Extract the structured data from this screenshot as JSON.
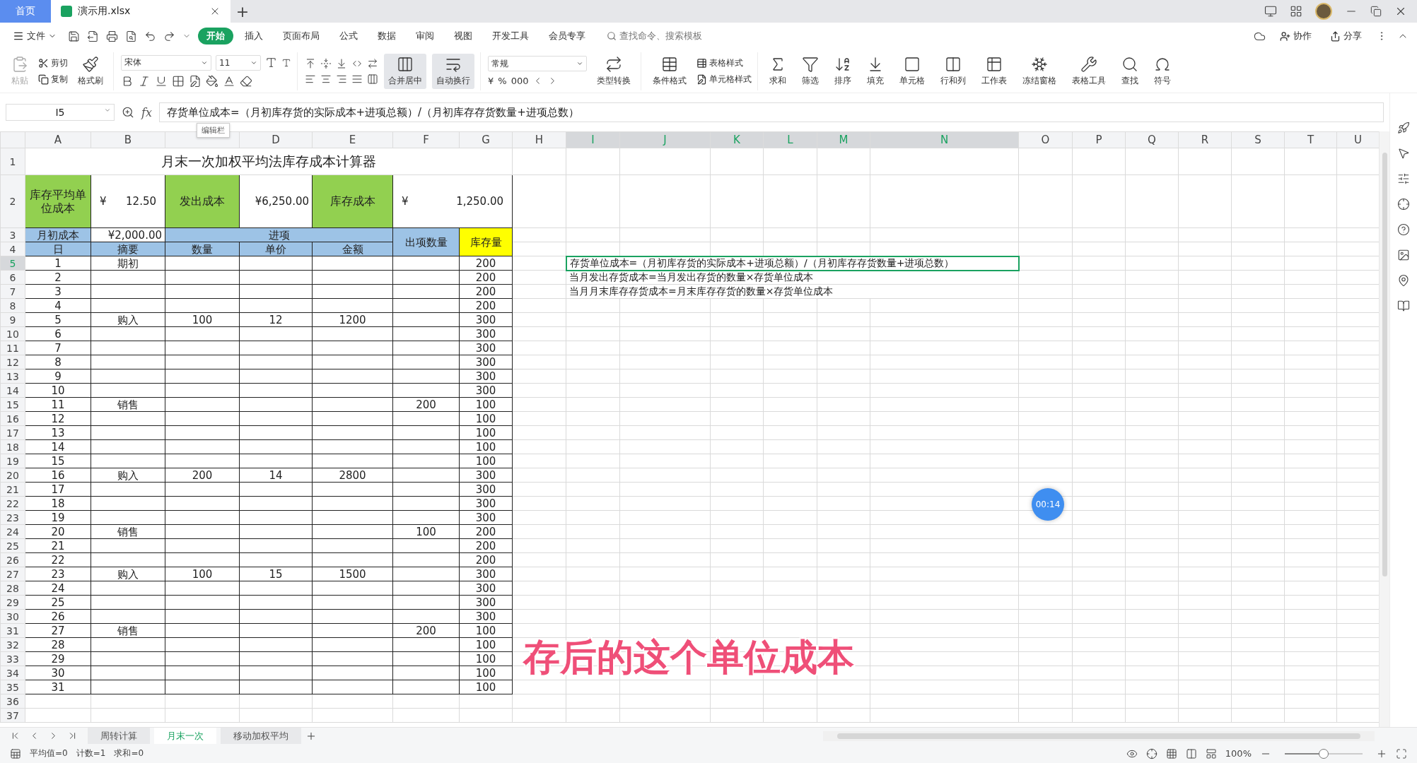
{
  "title_bar": {
    "tabs": [
      {
        "label": "首页",
        "kind": "home",
        "selected": false
      },
      {
        "label": "演示用.xlsx",
        "kind": "file",
        "selected": true
      }
    ],
    "new_tab": "+"
  },
  "menu": {
    "file": "文件",
    "items": [
      {
        "label": "开始",
        "selected": true
      },
      {
        "label": "插入",
        "selected": false
      },
      {
        "label": "页面布局",
        "selected": false
      },
      {
        "label": "公式",
        "selected": false
      },
      {
        "label": "数据",
        "selected": false
      },
      {
        "label": "审阅",
        "selected": false
      },
      {
        "label": "视图",
        "selected": false
      },
      {
        "label": "开发工具",
        "selected": false
      },
      {
        "label": "会员专享",
        "selected": false
      }
    ],
    "search_placeholder": "查找命令、搜索模板",
    "actions": [
      "协作",
      "分享"
    ]
  },
  "ribbon": {
    "paste": {
      "label": "粘贴",
      "disabled": true
    },
    "cut": "剪切",
    "copy": "复制",
    "format_painter": "格式刷",
    "font": "宋体",
    "font_size": "11",
    "merge": {
      "label": "合并居中",
      "active": true
    },
    "wrap": {
      "label": "自动换行",
      "active": true
    },
    "number_format": "常规",
    "currency": "¥",
    "percent": "%",
    "thousands": "000",
    "convert": "类型转换",
    "conditional": "条件格式",
    "table_style": "表格样式",
    "cell_style": "单元格样式",
    "tools": [
      "求和",
      "筛选",
      "排序",
      "填充",
      "单元格",
      "行和列",
      "工作表",
      "冻结窗格",
      "表格工具",
      "查找",
      "符号"
    ]
  },
  "formula_bar": {
    "name_box": "I5",
    "fx_label": "fx",
    "formula": "存货单位成本=（月初库存货的实际成本+进项总额）/（月初库存存货数量+进项总数）",
    "tooltip": "编辑栏"
  },
  "sheet": {
    "columns": [
      {
        "label": "A",
        "selected": false
      },
      {
        "label": "B",
        "selected": false
      },
      {
        "selected": false
      },
      {
        "label": "D",
        "selected": false
      },
      {
        "label": "E",
        "selected": false
      },
      {
        "label": "F",
        "selected": false
      },
      {
        "label": "G",
        "selected": false
      },
      {
        "label": "H",
        "selected": false
      },
      {
        "label": "I",
        "selected": true
      },
      {
        "label": "J",
        "selected": true
      },
      {
        "label": "K",
        "selected": true
      },
      {
        "label": "L",
        "selected": true
      },
      {
        "label": "M",
        "selected": true
      },
      {
        "label": "N",
        "selected": true
      },
      {
        "label": "O",
        "selected": false
      },
      {
        "label": "P",
        "selected": false
      },
      {
        "label": "Q",
        "selected": false
      },
      {
        "label": "R",
        "selected": false
      },
      {
        "label": "S",
        "selected": false
      },
      {
        "label": "T",
        "selected": false
      },
      {
        "label": "U",
        "selected": false
      }
    ],
    "row_headers": [
      {
        "label": "1",
        "selected": false
      },
      {
        "label": "2",
        "selected": false
      },
      {
        "label": "3",
        "selected": false
      },
      {
        "label": "4",
        "selected": false
      },
      {
        "label": "5",
        "selected": true
      },
      {
        "label": "6",
        "selected": false
      },
      {
        "label": "7",
        "selected": false
      },
      {
        "label": "8",
        "selected": false
      },
      {
        "label": "9",
        "selected": false
      },
      {
        "label": "10",
        "selected": false
      },
      {
        "label": "11",
        "selected": false
      },
      {
        "label": "12",
        "selected": false
      },
      {
        "label": "13",
        "selected": false
      },
      {
        "label": "14",
        "selected": false
      },
      {
        "label": "15",
        "selected": false
      },
      {
        "label": "16",
        "selected": false
      },
      {
        "label": "17",
        "selected": false
      },
      {
        "label": "18",
        "selected": false
      },
      {
        "label": "19",
        "selected": false
      },
      {
        "label": "20",
        "selected": false
      },
      {
        "label": "21",
        "selected": false
      },
      {
        "label": "22",
        "selected": false
      },
      {
        "label": "23",
        "selected": false
      },
      {
        "label": "24",
        "selected": false
      },
      {
        "label": "25",
        "selected": false
      },
      {
        "label": "26",
        "selected": false
      },
      {
        "label": "27",
        "selected": false
      },
      {
        "label": "28",
        "selected": false
      },
      {
        "label": "29",
        "selected": false
      },
      {
        "label": "30",
        "selected": false
      },
      {
        "label": "31",
        "selected": false
      },
      {
        "label": "32",
        "selected": false
      },
      {
        "label": "33",
        "selected": false
      },
      {
        "label": "34",
        "selected": false
      },
      {
        "label": "35",
        "selected": false
      },
      {
        "label": "36",
        "selected": false
      },
      {
        "label": "37",
        "selected": false
      }
    ],
    "title": "月末一次加权平均法库存成本计算器",
    "summary": [
      {
        "label": "库存平均单位成本",
        "value": {
          "currency": "¥",
          "amount": "12.50"
        }
      },
      {
        "label": "发出成本",
        "value": {
          "amount": "¥6,250.00"
        }
      },
      {
        "label": "库存成本",
        "value": {
          "currency": "¥",
          "amount": "1,250.00"
        }
      }
    ],
    "opening": {
      "label": "月初成本",
      "value": "¥2,000.00"
    },
    "headers": {
      "day": "日",
      "summary": "摘要",
      "in_group": "进项",
      "in_qty": "数量",
      "in_price": "单价",
      "in_amount": "金额",
      "out_qty": "出项数量",
      "stock": "库存量"
    },
    "entries": [
      {
        "day": "1",
        "summary": "期初",
        "stock": "200"
      },
      {
        "day": "2",
        "stock": "200"
      },
      {
        "day": "3",
        "stock": "200"
      },
      {
        "day": "4",
        "stock": "200"
      },
      {
        "day": "5",
        "summary": "购入",
        "in_qty": "100",
        "in_price": "12",
        "in_amount": "1200",
        "stock": "300"
      },
      {
        "day": "6",
        "stock": "300"
      },
      {
        "day": "7",
        "stock": "300"
      },
      {
        "day": "8",
        "stock": "300"
      },
      {
        "day": "9",
        "stock": "300"
      },
      {
        "day": "10",
        "stock": "300"
      },
      {
        "day": "11",
        "summary": "销售",
        "out_qty": "200",
        "stock": "100"
      },
      {
        "day": "12",
        "stock": "100"
      },
      {
        "day": "13",
        "stock": "100"
      },
      {
        "day": "14",
        "stock": "100"
      },
      {
        "day": "15",
        "stock": "100"
      },
      {
        "day": "16",
        "summary": "购入",
        "in_qty": "200",
        "in_price": "14",
        "in_amount": "2800",
        "stock": "300"
      },
      {
        "day": "17",
        "stock": "300"
      },
      {
        "day": "18",
        "stock": "300"
      },
      {
        "day": "19",
        "stock": "300"
      },
      {
        "day": "20",
        "summary": "销售",
        "out_qty": "100",
        "stock": "200"
      },
      {
        "day": "21",
        "stock": "200"
      },
      {
        "day": "22",
        "stock": "200"
      },
      {
        "day": "23",
        "summary": "购入",
        "in_qty": "100",
        "in_price": "15",
        "in_amount": "1500",
        "stock": "300"
      },
      {
        "day": "24",
        "stock": "300"
      },
      {
        "day": "25",
        "stock": "300"
      },
      {
        "day": "26",
        "stock": "300"
      },
      {
        "day": "27",
        "summary": "销售",
        "out_qty": "200",
        "stock": "100"
      },
      {
        "day": "28",
        "stock": "100"
      },
      {
        "day": "29",
        "stock": "100"
      },
      {
        "day": "30",
        "stock": "100"
      },
      {
        "day": "31",
        "stock": "100"
      }
    ],
    "notes": [
      {
        "text": "存货单位成本=（月初库存货的实际成本+进项总额）/（月初库存存货数量+进项总数）",
        "selected": true
      },
      {
        "text": "当月发出存货成本=当月发出存货的数量×存货单位成本",
        "selected": false
      },
      {
        "text": "当月月末库存存货成本=月末库存存货的数量×存货单位成本",
        "selected": false
      }
    ]
  },
  "sheet_tabs": [
    {
      "label": "周转计算",
      "selected": false
    },
    {
      "label": "月末一次",
      "selected": true
    },
    {
      "label": "移动加权平均",
      "selected": false
    }
  ],
  "status_bar": {
    "stats": [
      "平均值=0",
      "计数=1",
      "求和=0"
    ],
    "zoom": "100%",
    "zoom_slider": {
      "level": 0.5
    }
  },
  "overlay": {
    "caption": "存后的这个单位成本",
    "timer": "00:14"
  }
}
